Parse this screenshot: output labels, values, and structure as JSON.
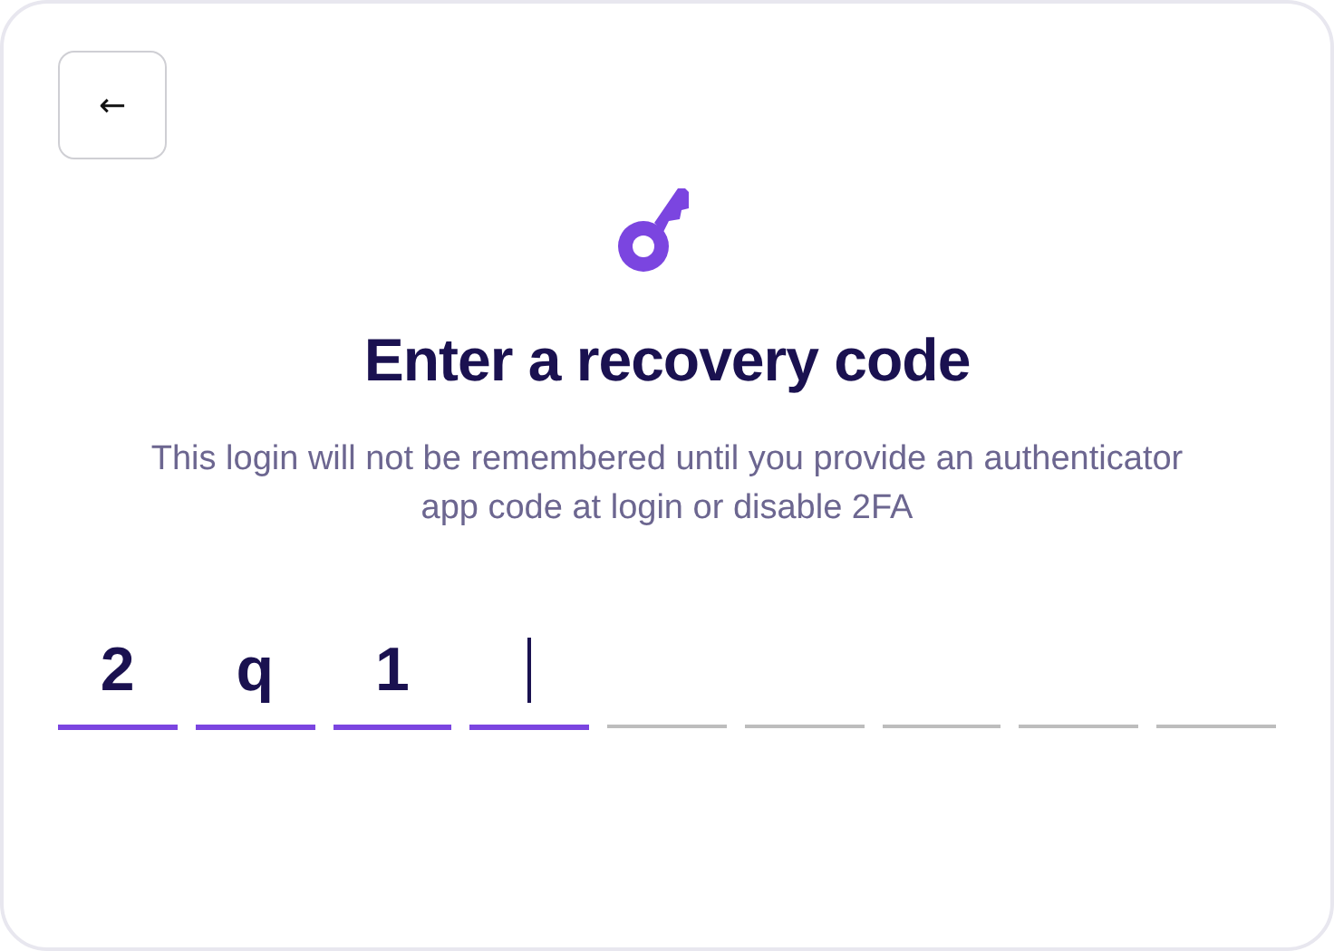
{
  "back_button": {
    "label": "←"
  },
  "title": "Enter a recovery code",
  "subtitle": "This login will not be remembered until you provide an authenticator app code at login or disable 2FA",
  "code_cells": [
    {
      "value": "2",
      "focused": false
    },
    {
      "value": "q",
      "focused": false
    },
    {
      "value": "1",
      "focused": false
    },
    {
      "focused": true
    },
    {
      "focused": false
    },
    {
      "focused": false
    },
    {
      "focused": false
    },
    {
      "focused": false
    },
    {
      "focused": false
    }
  ]
}
